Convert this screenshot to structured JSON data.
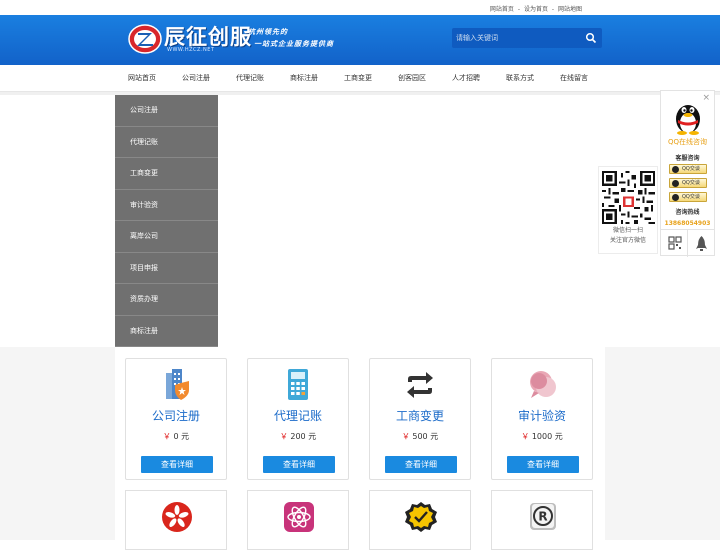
{
  "topbar": {
    "links": [
      "网站首页",
      "设为首页",
      "网站地图"
    ],
    "separator": "-"
  },
  "header": {
    "logo_text": "辰征创服",
    "logo_url": "WWW.HZCZ.NET",
    "slogan_line1": "杭州领先的",
    "slogan_line2": "一站式企业服务提供商",
    "search_placeholder": "请输入关键词",
    "brand_color": "#1a7fe0"
  },
  "nav": {
    "items": [
      "网站首页",
      "公司注册",
      "代理记账",
      "商标注册",
      "工商变更",
      "创客园区",
      "人才招聘",
      "联系方式",
      "在线留言"
    ]
  },
  "dropdown": {
    "items": [
      "公司注册",
      "代理记账",
      "工商变更",
      "审计验资",
      "离岸公司",
      "项目申报",
      "资质办理",
      "商标注册"
    ]
  },
  "services": [
    {
      "title": "公司注册",
      "currency": "￥",
      "price": "0",
      "unit": "元",
      "button": "查看详细",
      "icon": "buildings-shield-icon"
    },
    {
      "title": "代理记账",
      "currency": "￥",
      "price": "200",
      "unit": "元",
      "button": "查看详细",
      "icon": "calculator-icon"
    },
    {
      "title": "工商变更",
      "currency": "￥",
      "price": "500",
      "unit": "元",
      "button": "查看详细",
      "icon": "swap-arrows-icon"
    },
    {
      "title": "审计验资",
      "currency": "￥",
      "price": "1000",
      "unit": "元",
      "button": "查看详细",
      "icon": "speech-bubbles-icon"
    }
  ],
  "services_row2_icons": [
    "hongkong-flower-icon",
    "atom-icon",
    "badge-check-icon",
    "registered-trademark-icon"
  ],
  "qr": {
    "caption1": "微信扫一扫",
    "caption2": "关注官方微信"
  },
  "qq_panel": {
    "close": "×",
    "online_label": "QQ在线咨询",
    "section_service": "客服咨询",
    "qq_buttons": [
      "QQ交谈",
      "QQ交谈",
      "QQ交谈"
    ],
    "section_hotline": "咨询热线",
    "hotline": "13868054903"
  }
}
